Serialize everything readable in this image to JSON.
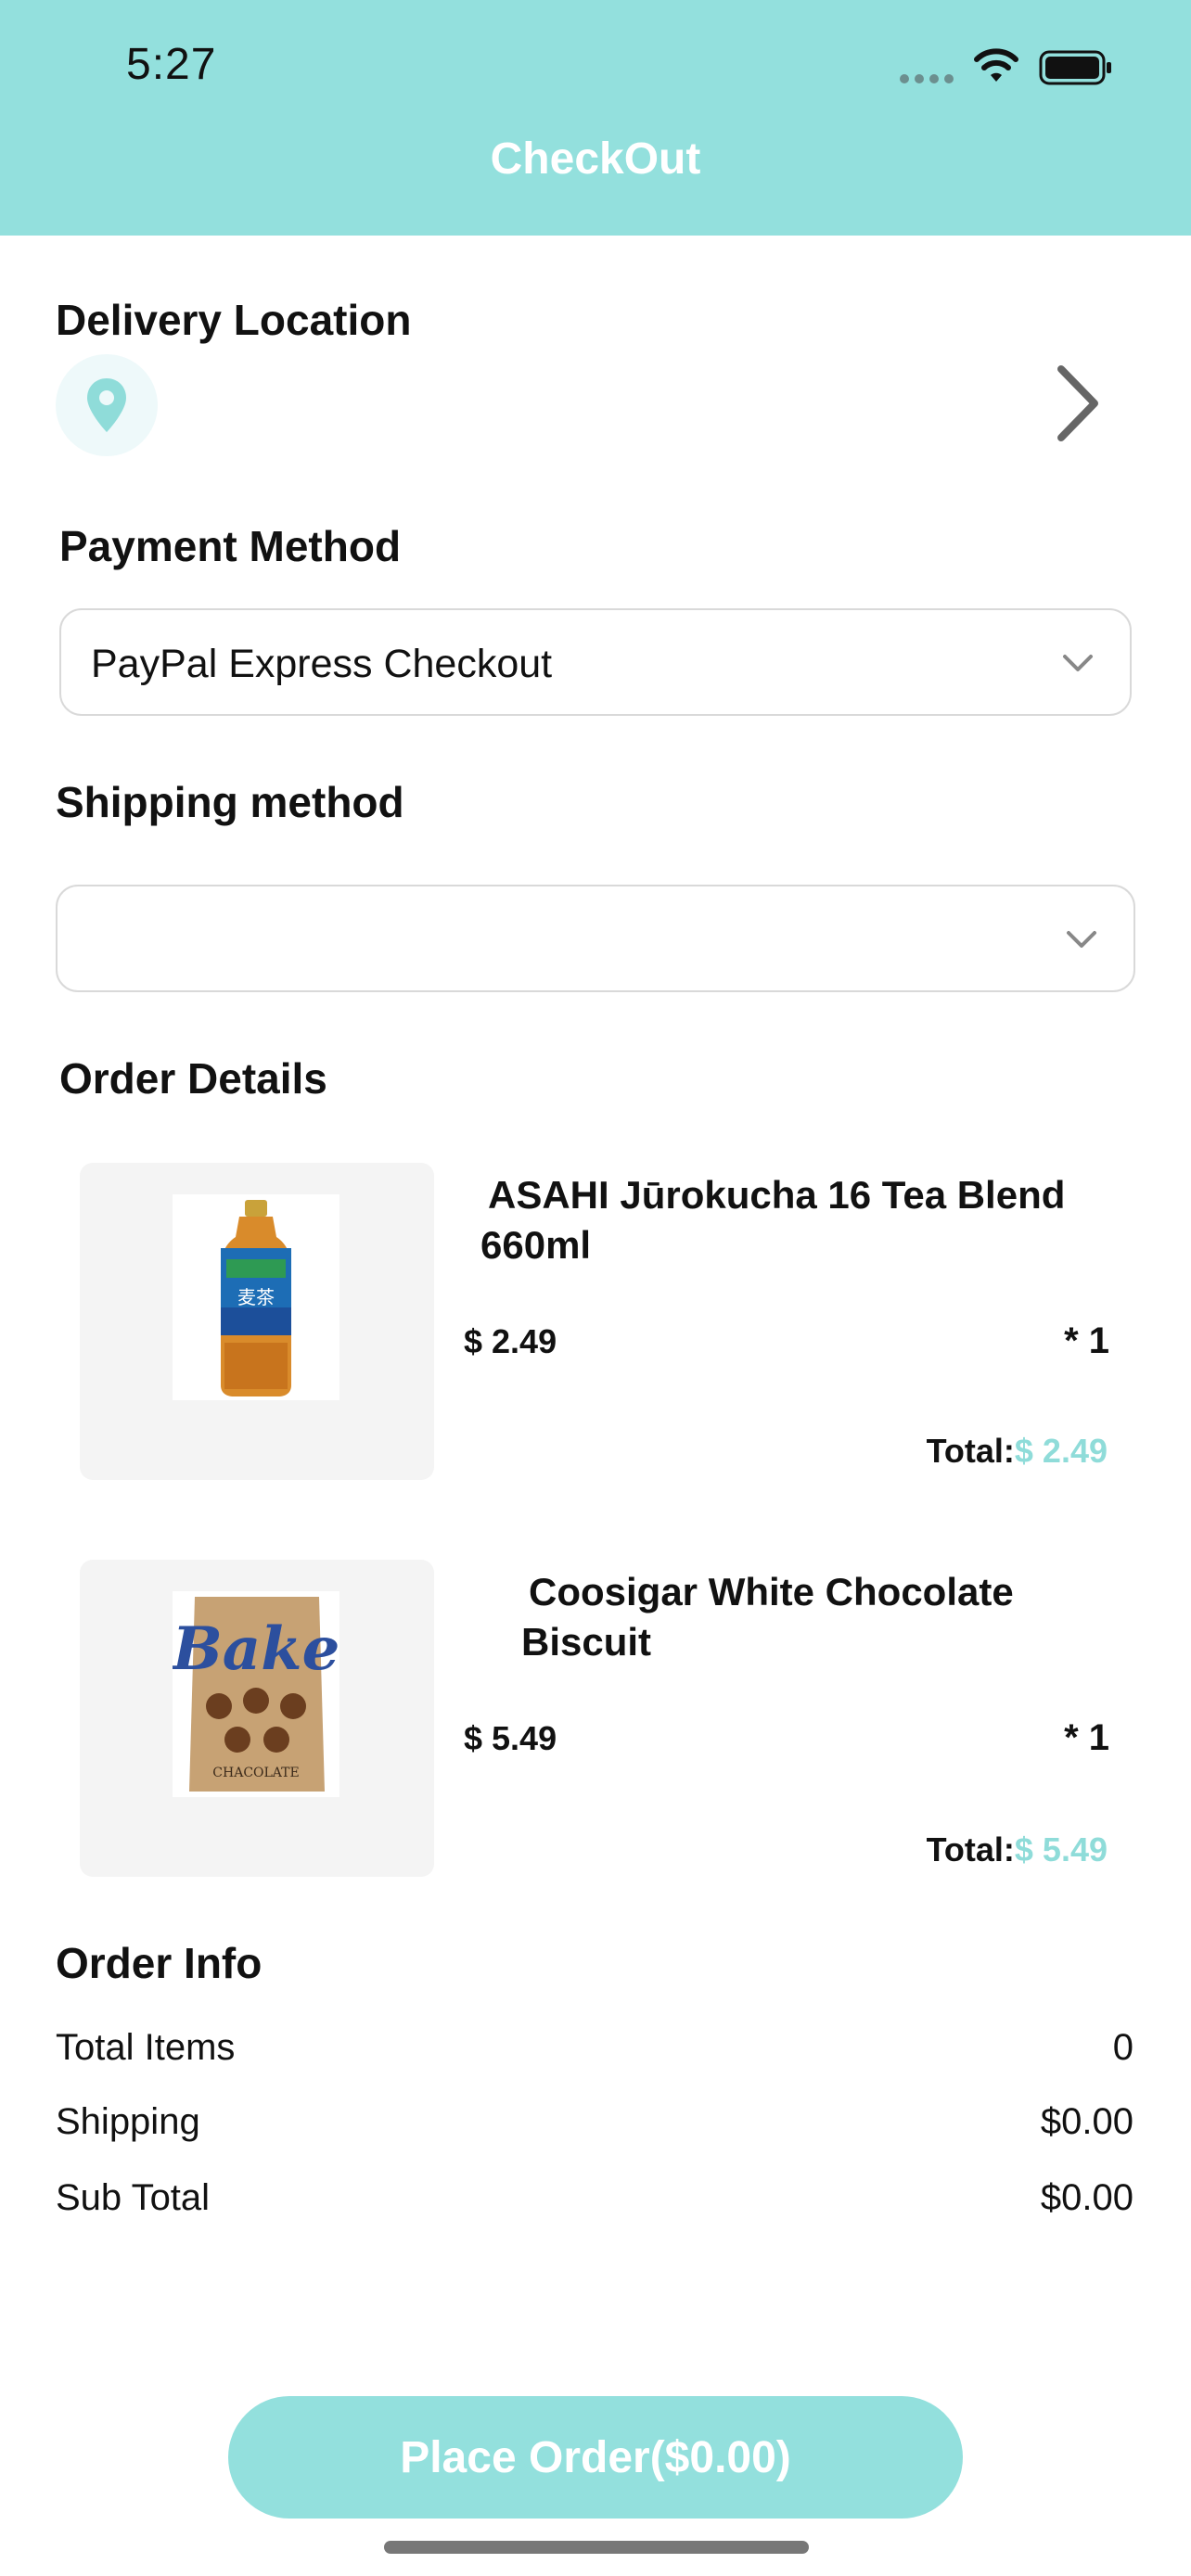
{
  "status_bar": {
    "time": "5:27"
  },
  "header": {
    "title": "CheckOut"
  },
  "delivery": {
    "title": "Delivery Location"
  },
  "payment": {
    "title": "Payment Method",
    "selected": "PayPal Express Checkout"
  },
  "shipping_method": {
    "title": "Shipping method",
    "selected": ""
  },
  "order_details": {
    "title": "Order Details",
    "items": [
      {
        "name_line1": "ASAHI Jūrokucha 16 Tea Blend",
        "name_line2": "660ml",
        "price": "$ 2.49",
        "qty": "* 1",
        "total_label": "Total:",
        "total_value": "$ 2.49"
      },
      {
        "name_line1": "Coosigar White Chocolate",
        "name_line2": "Biscuit",
        "price": "$ 5.49",
        "qty": "* 1",
        "total_label": "Total:",
        "total_value": "$ 5.49"
      }
    ]
  },
  "order_info": {
    "title": "Order Info",
    "rows": [
      {
        "label": "Total Items",
        "value": "0"
      },
      {
        "label": "Shipping",
        "value": "$0.00"
      },
      {
        "label": "Sub Total",
        "value": "$0.00"
      }
    ]
  },
  "place_order": {
    "label": "Place Order($0.00)"
  },
  "colors": {
    "accent": "#93e0dd",
    "accent_text": "#8fdcd9"
  },
  "icons": {
    "location": "location-pin-icon",
    "chevron_right": "chevron-right-icon",
    "chevron_down": "chevron-down-icon"
  }
}
